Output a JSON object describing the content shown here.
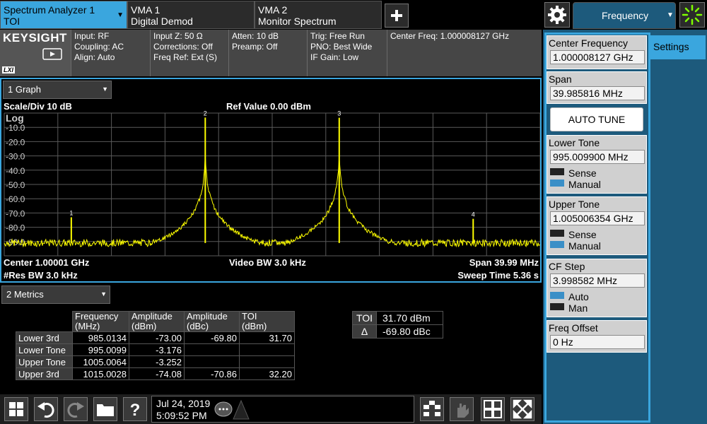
{
  "tabs": [
    {
      "title": "Spectrum Analyzer 1",
      "subtitle": "TOI"
    },
    {
      "title": "VMA 1",
      "subtitle": "Digital Demod"
    },
    {
      "title": "VMA 2",
      "subtitle": "Monitor Spectrum"
    }
  ],
  "menu_tab": {
    "label": "Frequency"
  },
  "brand": {
    "logo": "KEYSIGHT",
    "lxi": "LXI"
  },
  "info": {
    "col1": [
      "Input: RF",
      "Coupling: AC",
      "Align: Auto"
    ],
    "col2": [
      "Input Z: 50 Ω",
      "Corrections: Off",
      "Freq Ref: Ext (S)"
    ],
    "col3": [
      "Atten: 10 dB",
      "Preamp: Off"
    ],
    "col4": [
      "Trig: Free Run",
      "PNO: Best Wide",
      "IF Gain: Low"
    ],
    "col5": [
      "Center Freq: 1.000008127 GHz"
    ]
  },
  "graph": {
    "view_select": "1 Graph",
    "scale": "Scale/Div 10 dB",
    "ref_value": "Ref Value 0.00 dBm",
    "log_label": "Log",
    "center": "Center 1.00001 GHz",
    "res_bw": "#Res BW 3.0 kHz",
    "video_bw": "Video BW 3.0 kHz",
    "span": "Span 39.99 MHz",
    "sweep": "Sweep Time 5.36 s",
    "trace_color": "#ffff00"
  },
  "chart_data": {
    "type": "line",
    "y_ticks": [
      "-10.0",
      "-20.0",
      "-30.0",
      "-40.0",
      "-50.0",
      "-60.0",
      "-70.0",
      "-80.0",
      "-90.0"
    ],
    "ylim": [
      -100,
      0
    ],
    "xlim_ghz": [
      0.98001,
      1.02
    ],
    "noise_floor_dbm": -91,
    "markers": [
      {
        "label": "1",
        "freq_ghz": 0.9850134,
        "amplitude_dbm": -73.0
      },
      {
        "label": "2",
        "freq_ghz": 0.9950099,
        "amplitude_dbm": -3.176
      },
      {
        "label": "3",
        "freq_ghz": 1.0050064,
        "amplitude_dbm": -3.252
      },
      {
        "label": "4",
        "freq_ghz": 1.0150028,
        "amplitude_dbm": -74.08
      }
    ]
  },
  "metrics": {
    "view_select": "2 Metrics",
    "headers": [
      [
        "Frequency",
        "(MHz)"
      ],
      [
        "Amplitude",
        "(dBm)"
      ],
      [
        "Amplitude",
        "(dBc)"
      ],
      [
        "TOI",
        "(dBm)"
      ]
    ],
    "rows": [
      {
        "name": "Lower 3rd",
        "freq": "985.0134",
        "amp_dbm": "-73.00",
        "amp_dbc": "-69.80",
        "toi": "31.70"
      },
      {
        "name": "Lower Tone",
        "freq": "995.0099",
        "amp_dbm": "-3.176",
        "amp_dbc": "",
        "toi": ""
      },
      {
        "name": "Upper Tone",
        "freq": "1005.0064",
        "amp_dbm": "-3.252",
        "amp_dbc": "",
        "toi": ""
      },
      {
        "name": "Upper 3rd",
        "freq": "1015.0028",
        "amp_dbm": "-74.08",
        "amp_dbc": "-70.86",
        "toi": "32.20"
      }
    ],
    "summary": [
      {
        "label": "TOI",
        "value": "31.70 dBm"
      },
      {
        "label": "Δ",
        "value": "-69.80 dBc"
      }
    ]
  },
  "status": {
    "date": "Jul 24, 2019",
    "time": "5:09:52 PM"
  },
  "softkeys": {
    "settings_tab": "Settings",
    "center_freq": {
      "label": "Center Frequency",
      "value": "1.000008127 GHz"
    },
    "span": {
      "label": "Span",
      "value": "39.985816 MHz"
    },
    "auto_tune": "AUTO TUNE",
    "lower_tone": {
      "label": "Lower Tone",
      "value": "995.009900 MHz",
      "opt1": "Sense",
      "opt2": "Manual"
    },
    "upper_tone": {
      "label": "Upper Tone",
      "value": "1.005006354 GHz",
      "opt1": "Sense",
      "opt2": "Manual"
    },
    "cf_step": {
      "label": "CF Step",
      "value": "3.998582 MHz",
      "opt1": "Auto",
      "opt2": "Man"
    },
    "freq_offset": {
      "label": "Freq Offset",
      "value": "0 Hz"
    }
  },
  "colors": {
    "accent": "#3aa6de",
    "panel": "#1d5a7c",
    "trace": "#ffff00"
  }
}
